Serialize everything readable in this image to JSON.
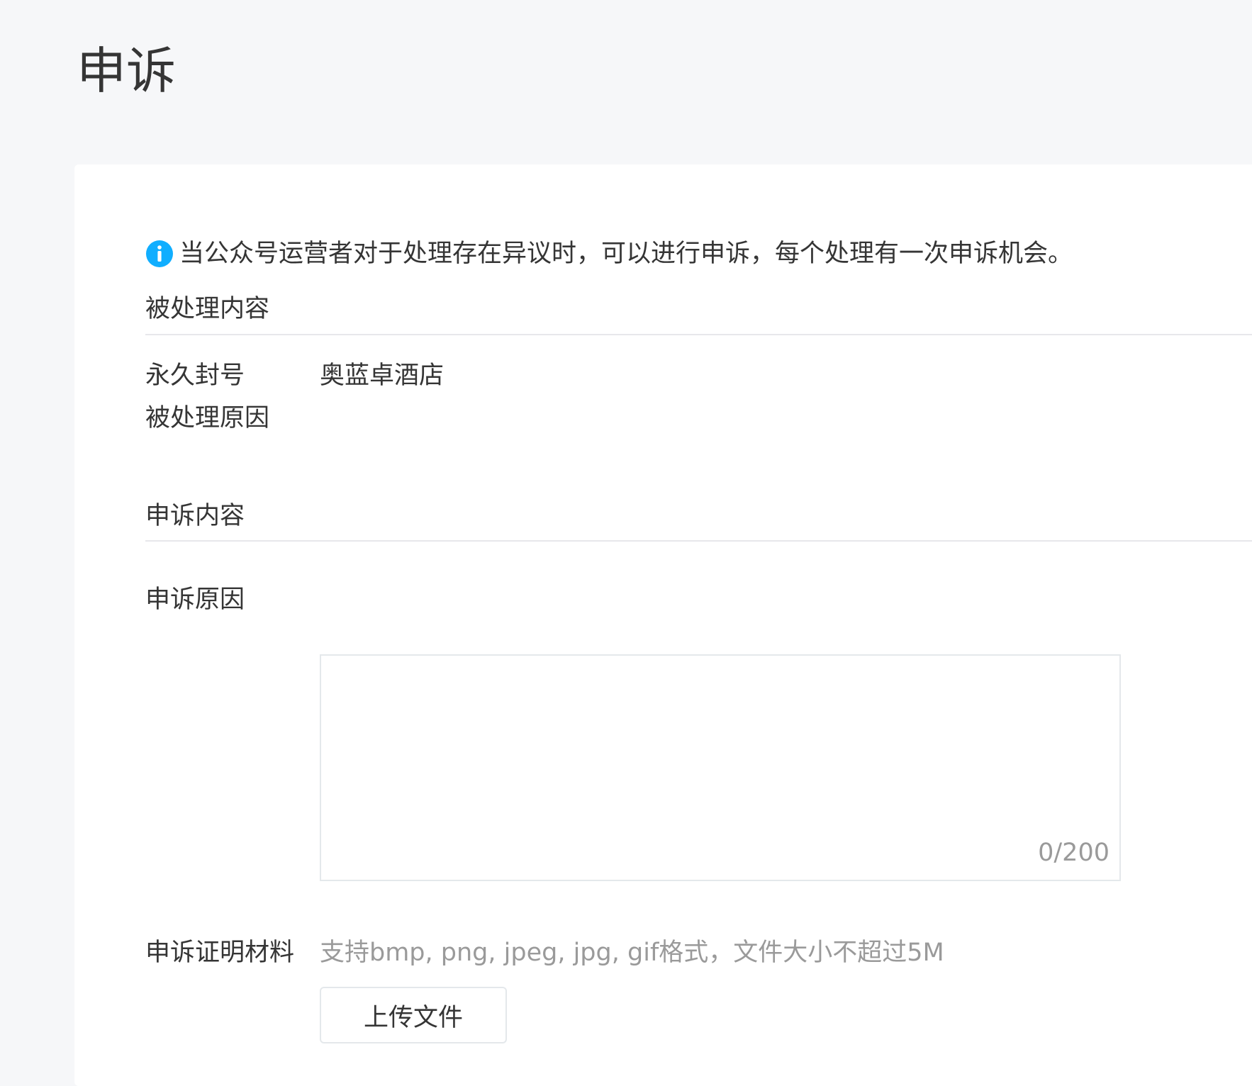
{
  "page": {
    "title": "申诉"
  },
  "notice": {
    "icon": "info-icon",
    "icon_color": "#10aeff",
    "text": "当公众号运营者对于处理存在异议时，可以进行申诉，每个处理有一次申诉机会。"
  },
  "processed_section": {
    "title": "被处理内容",
    "rows": [
      {
        "label": "永久封号",
        "value": "奥蓝卓酒店"
      },
      {
        "label": "被处理原因",
        "value": ""
      }
    ]
  },
  "appeal_section": {
    "title": "申诉内容",
    "reason": {
      "label": "申诉原因",
      "value": "",
      "counter": "0/200"
    },
    "evidence": {
      "label": "申诉证明材料",
      "hint": "支持bmp, png, jpeg, jpg, gif格式，文件大小不超过5M",
      "upload_label": "上传文件"
    }
  }
}
